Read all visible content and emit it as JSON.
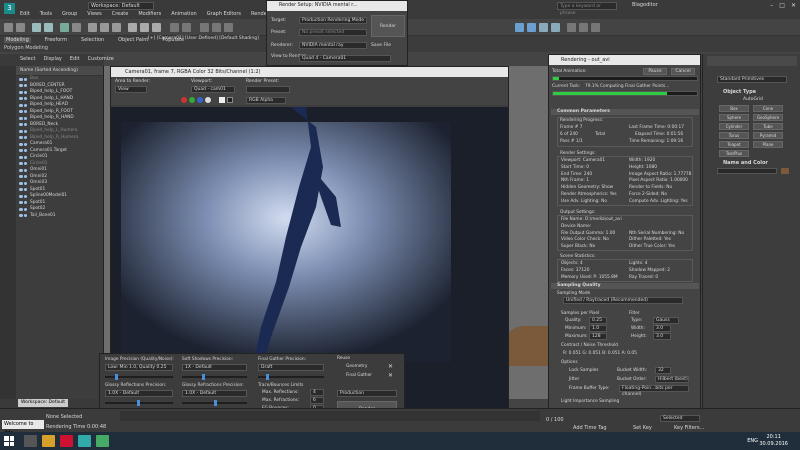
{
  "app": {
    "workspace": "Workspace: Default",
    "search": "Type a keyword or phrase",
    "user": "Blagoditor"
  },
  "menu": [
    "Edit",
    "Tools",
    "Group",
    "Views",
    "Create",
    "Modifiers",
    "Animation",
    "Graph Editors",
    "Rendering"
  ],
  "ribbon": {
    "tabs": [
      "Modeling",
      "Freeform",
      "Selection",
      "Object Paint",
      "Populate"
    ],
    "sub": "Polygon Modeling"
  },
  "ribbon_info": "[+] [Camera01] [User Defined] [Default Shading]",
  "scene_bar": [
    "Select",
    "Display",
    "Edit",
    "Customize"
  ],
  "scene": {
    "header": "Name (Sorted Ascending)",
    "rows": [
      {
        "name": "Box",
        "dim": true
      },
      {
        "name": "BORED_CENTER",
        "dim": false
      },
      {
        "name": "Biped_help_L_FOOT",
        "dim": false
      },
      {
        "name": "Biped_help_L_HAND",
        "dim": false
      },
      {
        "name": "Biped_help_HEAD",
        "dim": false
      },
      {
        "name": "Biped_help_R_FOOT",
        "dim": false
      },
      {
        "name": "Biped_help_R_HAND",
        "dim": false
      },
      {
        "name": "BORED_Neck",
        "dim": false
      },
      {
        "name": "Biped_help_L_Humera",
        "dim": true
      },
      {
        "name": "Biped_help_R_Humera",
        "dim": true
      },
      {
        "name": "Camera01",
        "dim": false
      },
      {
        "name": "Camera01.Target",
        "dim": false
      },
      {
        "name": "Circle01",
        "dim": false
      },
      {
        "name": "Circle01",
        "dim": true
      },
      {
        "name": "Omni01",
        "dim": false
      },
      {
        "name": "Omni02",
        "dim": false
      },
      {
        "name": "Omni03",
        "dim": false
      },
      {
        "name": "Spot01",
        "dim": false
      },
      {
        "name": "Spline00Model01",
        "dim": false
      },
      {
        "name": "Spot01",
        "dim": false
      },
      {
        "name": "Spot02",
        "dim": false
      },
      {
        "name": "Tail_Bone01",
        "dim": false
      }
    ]
  },
  "workspace_default": "Workspace: Default",
  "status": {
    "selected": "None Selected",
    "rendering": "Rendering Time 0:00:48",
    "cmd": "Welcome to 3ds",
    "frame": "0 / 100",
    "addtime": "Add Time Tag",
    "setkey": "Set Key",
    "keyfilters": "Key Filters...",
    "selected_opt": "Selected"
  },
  "frame_window": {
    "title": "Camera01, frame 7, RGBA Color 32 Bits/Channel (1:2)",
    "area_label": "Area to Render:",
    "area_value": "View",
    "viewport_label": "Viewport:",
    "viewport_value": "Quad - cam01",
    "preset_label": "Render Preset:",
    "channel": "RGB Alpha"
  },
  "lower_panel": {
    "image_precision": "Image Precision (Quality/Noise):",
    "image_precision_val": "Low: Min 1.0, Quality 0.25",
    "soft_shadows": "Soft Shadows Precision:",
    "soft_shadows_val": "1X - Default",
    "final_gather": "Final Gather Precision:",
    "final_gather_val": "Draft",
    "reuse": "Reuse",
    "geometry": "Geometry",
    "final_gather_chk": "Final Gather",
    "glossy_refl": "Glossy Reflections Precision:",
    "glossy_refl_val": "1.0X - Default",
    "glossy_refr": "Glossy Refractions Precision:",
    "glossy_refr_val": "1.0X - Default",
    "trace_limits": "Trace/Bounces Limits",
    "max_refl": "Max. Reflections:",
    "max_refl_val": "4",
    "max_refr": "Max. Refractions:",
    "max_refr_val": "6",
    "fg_bounces": "FG Bounces:",
    "fg_bounces_val": "0",
    "production": "Production",
    "render": "Render"
  },
  "setup": {
    "title": "Render Setup: NVIDIA mental r...",
    "target_label": "Target:",
    "target_val": "Production Rendering Mode",
    "preset_label": "Preset:",
    "preset_val": "No preset selected",
    "renderer_label": "Renderer:",
    "renderer_val": "NVIDIA mental ray",
    "save_file": "Save File",
    "view_label": "View to Render:",
    "view_val": "Quad 4 - Camera01",
    "render_btn": "Render"
  },
  "rendering": {
    "title": "Rendering - out_avi",
    "pause": "Pause",
    "cancel": "Cancel",
    "total_anim": "Total Animation:",
    "total_pct": 0.04,
    "current_task_label": "Current Task:",
    "current_task": "79.1%   Computing Final Gather Points...",
    "current_pct": 0.79,
    "common_params": "Common Parameters",
    "progress_hdr": "Rendering Progress:",
    "frame": "Frame #  7",
    "last_frame": "Last Frame Time:  0:00:17",
    "of": "6 of   240",
    "total": "Total",
    "elapsed": "Elapsed Time:  0:01:56",
    "pass": "Pass #  1/1",
    "remaining": "Time Remaining:  1:09:16",
    "settings_hdr": "Render Settings:",
    "settings": [
      [
        "Viewport: Camera01",
        "Width: 1920"
      ],
      [
        "Start Time: 0",
        "Height: 1080"
      ],
      [
        "End Time: 240",
        "Image Aspect Ratio: 1.77778"
      ],
      [
        "Nth Frame: 1",
        "Pixel Aspect Ratio: 1.00000"
      ],
      [
        "Hidden Geometry: Show",
        "Render to Fields: No"
      ],
      [
        "Render Atmospherics: Yes",
        "Force 2-Sided: No"
      ],
      [
        "Use Adv. Lighting: No",
        "Compute Adv. Lighting: Yes"
      ]
    ],
    "output_hdr": "Output Settings:",
    "output": [
      [
        "File Name: D:\\media\\out_avi",
        ""
      ],
      [
        "Device Name:",
        ""
      ],
      [
        "File Output Gamma: 1.00",
        "Nth Serial Numbering: No"
      ],
      [
        "Video Color Check: No",
        "Dither Paletted: Yes"
      ],
      [
        "Super Black: No",
        "Dither True Color: Yes"
      ]
    ],
    "scene_hdr": "Scene Statistics:",
    "scene": [
      [
        "Objects: 4",
        "Lights: 4"
      ],
      [
        "Faces: 37120",
        "Shadow Mapped: 2"
      ],
      [
        "Memory Used: P: 1055.8M",
        "Ray Traced: 0"
      ]
    ],
    "sampling": "Sampling Quality",
    "sampling_mode": "Sampling Mode",
    "sampling_val": "Unified / Raytraced (Recommended)",
    "samples_per_pixel": "Samples per Pixel",
    "filter": "Filter",
    "quality": "Quality:",
    "quality_val": "0.25",
    "type": "Type:",
    "type_val": "Gauss",
    "minimum": "Minimum:",
    "minimum_val": "1.0",
    "width": "Width:",
    "width_val": "3.0",
    "maximum": "Maximum:",
    "maximum_val": "128",
    "height": "Height:",
    "height_val": "3.0",
    "contrast": "Contrast / Noise Threshold",
    "contrast_vals": "R: 0.051   G: 0.051   B: 0.051   A: 0.05",
    "options": "Options",
    "lock_samples": "Lock Samples",
    "bucket_width": "Bucket Width:",
    "bucket_width_val": "32",
    "jitter": "Jitter",
    "bucket_order": "Bucket Order:",
    "bucket_order_val": "Hilbert (best)",
    "frame_buffer": "Frame Buffer Type:",
    "frame_buffer_val": "Floating-Poin...bits per channel)",
    "light_imp": "Light Importance Sampling"
  },
  "cmd_panel": {
    "dropdown": "Standard Primitives",
    "object_type": "Object Type",
    "autogrid": "AutoGrid",
    "buttons": [
      "Box",
      "Cone",
      "Sphere",
      "GeoSphere",
      "Cylinder",
      "Tube",
      "Torus",
      "Pyramid",
      "Teapot",
      "Plane",
      "TextPlus"
    ],
    "name_color": "Name and Color"
  },
  "taskbar": {
    "lang": "ENG",
    "time": "20:11",
    "date": "30.09.2016"
  },
  "colors": {
    "accent": "#4d8fd6",
    "progress": "#2ecc40",
    "render_bg": "#2b3442"
  }
}
